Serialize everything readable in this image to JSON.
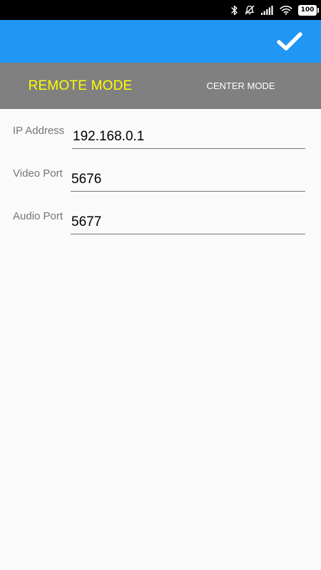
{
  "status_bar": {
    "icons": [
      "bluetooth-icon",
      "notifications-off-icon",
      "signal-icon",
      "wifi-icon"
    ],
    "battery_level": "100"
  },
  "app_bar": {
    "confirm_icon": "check-icon",
    "color": "#2196f3"
  },
  "tabs": [
    {
      "label": "REMOTE MODE",
      "selected": true,
      "color": "#ffff00"
    },
    {
      "label": "CENTER MODE",
      "selected": false,
      "color": "#ffffff"
    }
  ],
  "form": {
    "ip_address": {
      "label": "IP Address",
      "value": "192.168.0.1"
    },
    "video_port": {
      "label": "Video Port",
      "value": "5676"
    },
    "audio_port": {
      "label": "Audio Port",
      "value": "5677"
    }
  }
}
